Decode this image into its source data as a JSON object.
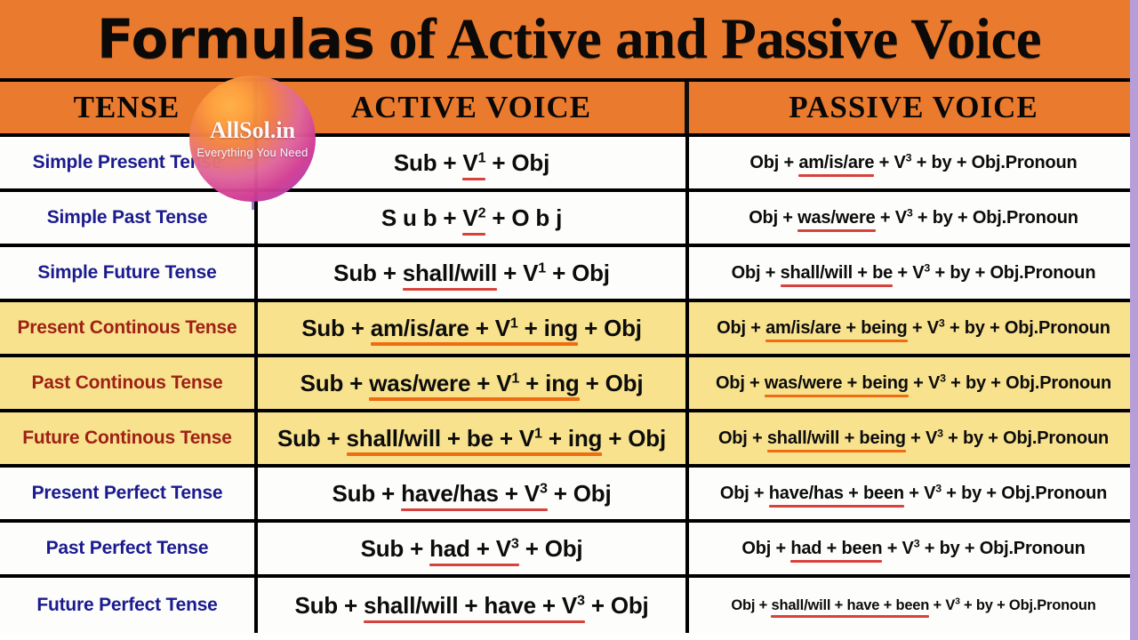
{
  "banner": {
    "title_lead": "Formulas",
    "title_rest": " of Active and Passive Voice"
  },
  "watermark": {
    "name": "AllSol.in",
    "tagline": "Everything You Need"
  },
  "colors": {
    "banner_bg": "#ea7a2e",
    "header_bg": "#ea7a2e",
    "row_white": "#fdfdfb",
    "row_yellow": "#f8e28d",
    "tense_blue": "#1b1b8f",
    "tense_red": "#9e2117",
    "underline_red": "#d8413c",
    "underline_orange": "#ef6c12",
    "edge_strip": "#b79ed8"
  },
  "table": {
    "headers": {
      "tense": "TENSE",
      "active": "ACTIVE VOICE",
      "passive": "PASSIVE VOICE"
    },
    "rows": [
      {
        "tense": "Simple Present Tense",
        "style": "white",
        "active": {
          "pre": "Sub  +  ",
          "hl": "V¹",
          "post": "  +  Obj"
        },
        "passive": {
          "pre": "Obj + ",
          "hl": "am/is/are",
          "post": " + V³ + by + Obj.Pronoun"
        }
      },
      {
        "tense": "Simple Past Tense",
        "style": "white",
        "active": {
          "pre": "S u b  + ",
          "hl": "V²",
          "post": " +  O b j"
        },
        "passive": {
          "pre": "Obj + ",
          "hl": "was/were",
          "post": " + V³ + by + Obj.Pronoun"
        }
      },
      {
        "tense": "Simple Future Tense",
        "style": "white",
        "active": {
          "pre": "Sub + ",
          "hl": "shall/will",
          "post": " + V¹ + Obj"
        },
        "passive": {
          "pre": "Obj + ",
          "hl": "shall/will + be",
          "post": " + V³ + by + Obj.Pronoun"
        }
      },
      {
        "tense": "Present Continous Tense",
        "style": "yellow",
        "active": {
          "pre": "Sub + ",
          "hl": "am/is/are + V¹ + ing",
          "post": " + Obj"
        },
        "passive": {
          "pre": "Obj + ",
          "hl": "am/is/are + being",
          "post": " + V³ + by + Obj.Pronoun"
        }
      },
      {
        "tense": "Past Continous Tense",
        "style": "yellow",
        "active": {
          "pre": "Sub + ",
          "hl": "was/were + V¹ + ing",
          "post": " + Obj"
        },
        "passive": {
          "pre": "Obj + ",
          "hl": "was/were + being",
          "post": " + V³ + by + Obj.Pronoun"
        }
      },
      {
        "tense": "Future Continous Tense",
        "style": "yellow",
        "active": {
          "pre": "Sub + ",
          "hl": "shall/will + be + V¹ + ing",
          "post": " + Obj"
        },
        "passive": {
          "pre": "Obj + ",
          "hl": "shall/will + being",
          "post": " + V³ + by + Obj.Pronoun"
        }
      },
      {
        "tense": "Present Perfect Tense",
        "style": "white",
        "active": {
          "pre": "Sub + ",
          "hl": "have/has + V³",
          "post": " + Obj"
        },
        "passive": {
          "pre": "Obj + ",
          "hl": "have/has + been",
          "post": " + V³ + by + Obj.Pronoun"
        }
      },
      {
        "tense": "Past Perfect Tense",
        "style": "white",
        "active": {
          "pre": "Sub + ",
          "hl": "had + V³",
          "post": " + Obj"
        },
        "passive": {
          "pre": "Obj + ",
          "hl": "had + been",
          "post": " + V³ + by + Obj.Pronoun"
        }
      },
      {
        "tense": "Future Perfect Tense",
        "style": "white",
        "active": {
          "pre": "Sub + ",
          "hl": "shall/will + have + V³",
          "post": " + Obj"
        },
        "passive": {
          "pre": "Obj + ",
          "hl": "shall/will + have + been",
          "post": " + V³ + by + Obj.Pronoun"
        }
      }
    ]
  }
}
